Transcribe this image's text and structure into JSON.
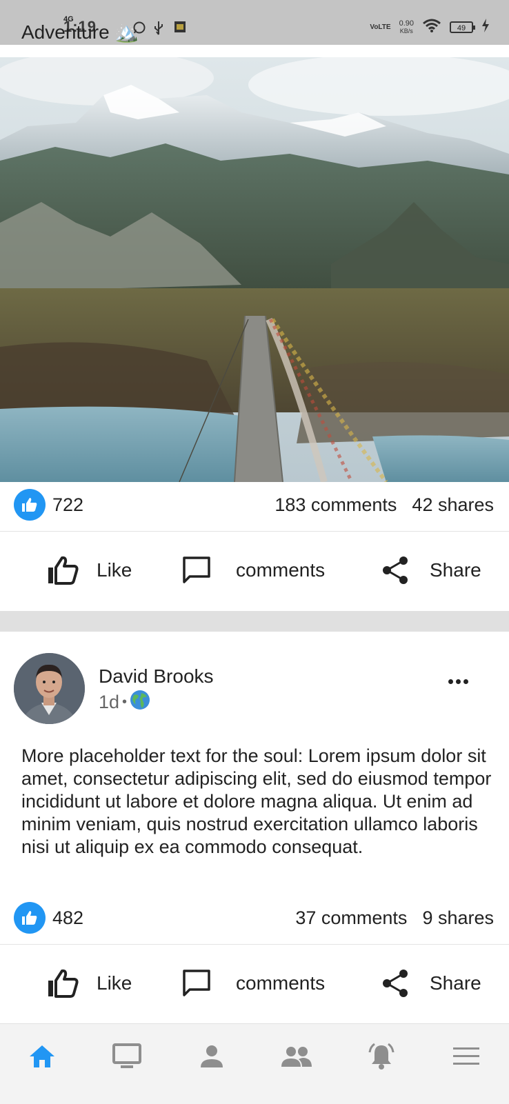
{
  "status_bar": {
    "post_title": "Adventure 🏔️",
    "time": "1:19",
    "network": "4G",
    "volte": "VoLTE",
    "speed_value": "0.90",
    "speed_unit": "KB/s",
    "battery": "49"
  },
  "post1": {
    "likes": "722",
    "comments": "183 comments",
    "shares": "42 shares",
    "actions": {
      "like": "Like",
      "comment": "comments",
      "share": "Share"
    }
  },
  "post2": {
    "author": "David Brooks",
    "time_ago": "1d",
    "separator": "•",
    "text": "More placeholder text for the soul: Lorem ipsum dolor sit amet, consectetur adipiscing elit, sed do eiusmod tempor incididunt ut labore et dolore magna aliqua. Ut enim ad minim veniam, quis nostrud exercitation ullamco laboris nisi ut aliquip ex ea commodo consequat.",
    "likes": "482",
    "comments": "37 comments",
    "shares": "9 shares",
    "actions": {
      "like": "Like",
      "comment": "comments",
      "share": "Share"
    }
  },
  "bottom_nav": {
    "items": [
      {
        "icon": "home-icon",
        "active": true
      },
      {
        "icon": "monitor-icon",
        "active": false
      },
      {
        "icon": "person-icon",
        "active": false
      },
      {
        "icon": "group-icon",
        "active": false
      },
      {
        "icon": "notification-bell-icon",
        "active": false
      },
      {
        "icon": "menu-icon",
        "active": false
      }
    ]
  },
  "colors": {
    "accent": "#2196f3",
    "icon_gray": "#8e8e8e",
    "band": "#e0e0e0"
  }
}
